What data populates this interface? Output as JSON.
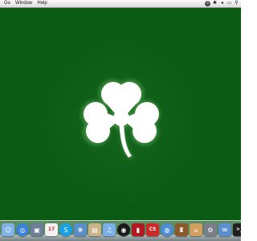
{
  "menubar": {
    "items": [
      "Go",
      "Window",
      "Help"
    ],
    "status_icons": [
      "power-icon",
      "bluetooth-icon",
      "volume-icon",
      "battery-icon",
      "search-icon"
    ]
  },
  "desktop": {
    "background_color": "#0b5a14",
    "wallpaper_icon": "shamrock-icon",
    "shamrock_color": "#ffffff"
  },
  "dock": {
    "items": [
      {
        "name": "finder-icon",
        "color": "#7fb2e6",
        "glyph": "☺"
      },
      {
        "name": "safari-icon",
        "color": "#3c82d8",
        "glyph": "◎"
      },
      {
        "name": "photo-icon",
        "color": "#6d7f99",
        "glyph": "▣"
      },
      {
        "name": "ical-icon",
        "color": "#f2f2f2",
        "glyph": "17"
      },
      {
        "name": "skype-icon",
        "color": "#19a3e6",
        "glyph": "S"
      },
      {
        "name": "network-icon",
        "color": "#5a8ec9",
        "glyph": "❋"
      },
      {
        "name": "notes-icon",
        "color": "#c9b48a",
        "glyph": "▤"
      },
      {
        "name": "itunes-icon",
        "color": "#7bb0e8",
        "glyph": "♫"
      },
      {
        "name": "dvd-icon",
        "color": "#1a1a1a",
        "glyph": "◉"
      },
      {
        "name": "book-icon",
        "color": "#b01b22",
        "glyph": "▮"
      },
      {
        "name": "creative-suite-icon",
        "color": "#cc2a2a",
        "glyph": "CS"
      },
      {
        "name": "chat-icon",
        "color": "#4f8ed6",
        "glyph": "◍"
      },
      {
        "name": "remote-icon",
        "color": "#8d5a2b",
        "glyph": "♜"
      },
      {
        "name": "coffee-icon",
        "color": "#d0a060",
        "glyph": "☕"
      },
      {
        "name": "settings-icon",
        "color": "#7a7f8a",
        "glyph": "⚙"
      },
      {
        "name": "mail-icon",
        "color": "#5b8fd0",
        "glyph": "✉"
      },
      {
        "name": "terminal-icon",
        "color": "#202020",
        "glyph": ">_"
      },
      {
        "name": "folder-icon",
        "color": "#8fb6e8",
        "glyph": "▰"
      }
    ]
  }
}
